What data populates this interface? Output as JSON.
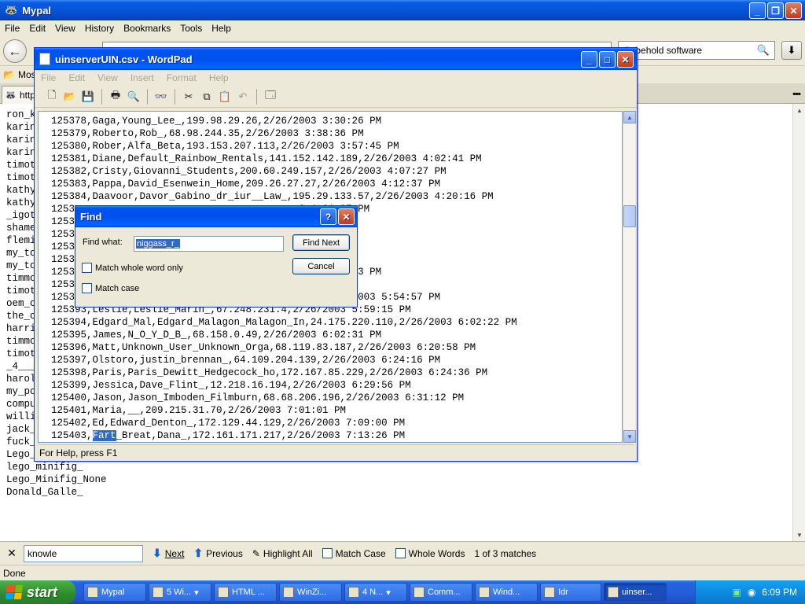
{
  "browser": {
    "title": "Mypal",
    "menu": [
      "File",
      "Edit",
      "View",
      "History",
      "Bookmarks",
      "Tools",
      "Help"
    ],
    "search_value": "behold software",
    "bookmarks_label": "Most",
    "tab_label": "http",
    "content_lines": [
      "ron_k",
      "karin",
      "karin",
      "karin",
      "timot",
      "timot",
      "kathy",
      "kathy",
      "_igot",
      "shame",
      "flemi",
      "my_to",
      "my_to",
      "timmo",
      "timot",
      "oem_c",
      "the_c",
      "harri",
      "timmo",
      "timot",
      "_4___",
      "harol",
      "my_pc",
      "compu",
      "willi",
      "jack_",
      "fuck_",
      "Lego_",
      "lego_minifig_",
      "Lego_Minifig_None",
      "Donald_Galle_"
    ],
    "find_bar": {
      "value": "knowle",
      "next_label": "Next",
      "previous_label": "Previous",
      "highlight_label": "Highlight All",
      "match_case_label": "Match Case",
      "whole_words_label": "Whole Words",
      "result": "1 of 3 matches"
    },
    "status": "Done"
  },
  "wordpad": {
    "title": "uinserverUIN.csv - WordPad",
    "menu": [
      "File",
      "Edit",
      "View",
      "Insert",
      "Format",
      "Help"
    ],
    "status": "For Help, press F1",
    "lines": [
      "125378,Gaga,Young_Lee_,199.98.29.26,2/26/2003 3:30:26 PM",
      "125379,Roberto,Rob_,68.98.244.35,2/26/2003 3:38:36 PM",
      "125380,Rober,Alfa_Beta,193.153.207.113,2/26/2003 3:57:45 PM",
      "125381,Diane,Default_Rainbow_Rentals,141.152.142.189,2/26/2003 4:02:41 PM",
      "125382,Cristy,Giovanni_Students,200.60.249.157,2/26/2003 4:07:27 PM",
      "125383,Pappa,David_Esenwein_Home,209.26.27.27,2/26/2003 4:12:37 PM",
      "125384,Daavoor,Davor_Gabino_dr_iur__Law_,195.29.133.57,2/26/2003 4:20:16 PM",
      "1253                                      3 4:31:27 PM",
      "1253                                       :33:57 PM",
      "1253                                       PM",
      "1253                                       39:08 PM",
      "1253",
      "1253                                       03 5:39:43 PM",
      "1253",
      "1253                                     .186,2/26/2003 5:54:57 PM",
      "125393,Leslie,Leslie_Marin_,67.248.231.4,2/26/2003 5:59:15 PM",
      "125394,Edgard_Mal,Edgard_Malagon_Malagon_In,24.175.220.110,2/26/2003 6:02:22 PM",
      "125395,James,N_O_Y_D_B_,68.158.0.49,2/26/2003 6:02:31 PM",
      "125396,Matt,Unknown_User_Unknown_Orga,68.119.83.187,2/26/2003 6:20:58 PM",
      "125397,Olstoro,justin_brennan_,64.109.204.139,2/26/2003 6:24:16 PM",
      "125398,Paris,Paris_Dewitt_Hedgecock_ho,172.167.85.229,2/26/2003 6:24:36 PM",
      "125399,Jessica,Dave_Flint_,12.218.16.194,2/26/2003 6:29:56 PM",
      "125400,Jason,Jason_Imboden_Filmburn,68.68.206.196,2/26/2003 6:31:12 PM",
      "125401,Maria,__,209.215.31.70,2/26/2003 7:01:01 PM",
      "125402,Ed,Edward_Denton_,172.129.44.129,2/26/2003 7:09:00 PM"
    ],
    "last_line_prefix": "125403,",
    "last_line_highlight": "Fart",
    "last_line_suffix": "_Breat,Dana_,172.161.171.217,2/26/2003 7:13:26 PM"
  },
  "find_dialog": {
    "title": "Find",
    "find_what_label": "Find what:",
    "find_what_value": "niggass_r_",
    "match_whole_word": "Match whole word only",
    "match_case": "Match case",
    "find_next": "Find Next",
    "cancel": "Cancel"
  },
  "taskbar": {
    "start": "start",
    "tasks": [
      "Mypal",
      "5 Wi...",
      "HTML ...",
      "WinZi...",
      "4 N...",
      "Comm...",
      "Wind...",
      "Idr",
      "uinser..."
    ],
    "clock": "6:09 PM"
  }
}
